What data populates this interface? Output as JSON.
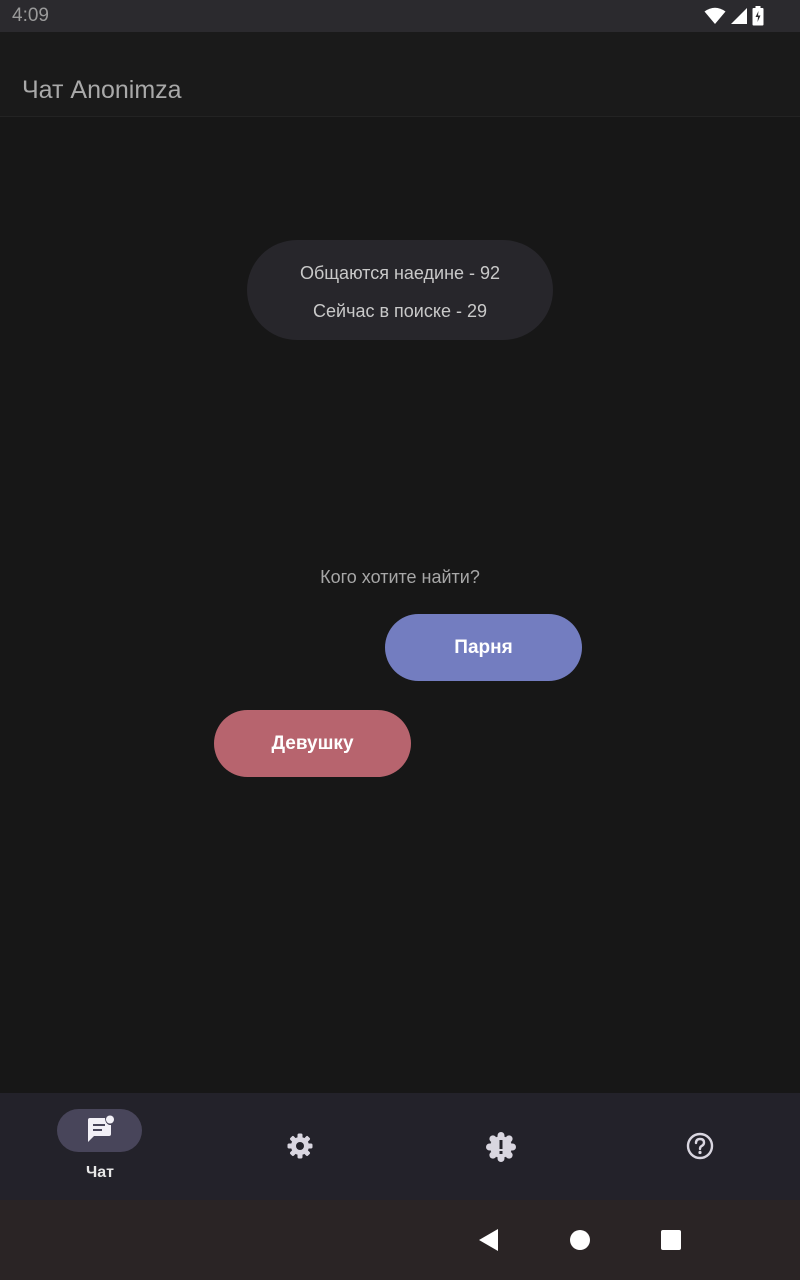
{
  "status_bar": {
    "time": "4:09",
    "icons": [
      "wifi-icon",
      "signal-icon",
      "battery-icon"
    ]
  },
  "app_bar": {
    "title": "Чат Anonimza"
  },
  "stats": {
    "chatting_privately": "Общаются наедине - 92",
    "searching_now": "Сейчас в поиске - 29"
  },
  "search": {
    "prompt": "Кого хотите найти?",
    "guy_label": "Парня",
    "girl_label": "Девушку"
  },
  "bottom_nav": {
    "items": [
      {
        "id": "chat",
        "label": "Чат",
        "icon": "chat-badge-icon",
        "active": true
      },
      {
        "id": "settings",
        "label": "",
        "icon": "gear-icon",
        "active": false
      },
      {
        "id": "report",
        "label": "",
        "icon": "alert-badge-icon",
        "active": false
      },
      {
        "id": "help",
        "label": "",
        "icon": "help-circle-icon",
        "active": false
      }
    ]
  },
  "system_nav": {
    "icons": [
      "back-icon",
      "home-icon",
      "recents-icon"
    ]
  },
  "colors": {
    "background": "#171717",
    "guy_button": "#737dc0",
    "girl_button": "#b7646e",
    "stats_pill": "#27262b",
    "nav_indicator": "#48455a"
  }
}
